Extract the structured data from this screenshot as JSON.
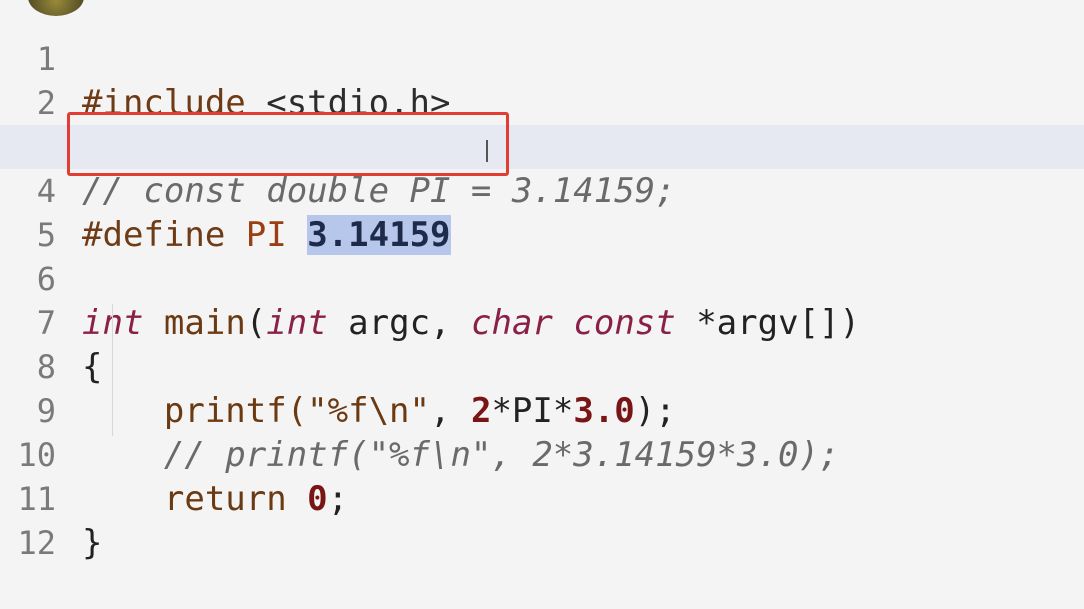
{
  "editor": {
    "lines": [
      {
        "no": "1",
        "tokens": [
          "#include",
          " <stdio.h>"
        ]
      },
      {
        "no": "2"
      },
      {
        "no": "3",
        "comment": "// const double PI = 3.14159;"
      },
      {
        "no": "4",
        "tokens": [
          "#define",
          " ",
          "PI",
          " ",
          "3.14159"
        ]
      },
      {
        "no": "5"
      },
      {
        "no": "6",
        "tokens": [
          "int",
          " ",
          "main",
          "(",
          "int",
          " argc, ",
          "char",
          " ",
          "const",
          " *argv[])"
        ]
      },
      {
        "no": "7",
        "tokens": [
          "{"
        ]
      },
      {
        "no": "8",
        "tokens": [
          "    printf(",
          "\"%f\\n\"",
          ", ",
          "2",
          "*PI*",
          "3.0",
          ");"
        ]
      },
      {
        "no": "9",
        "comment": "    // printf(\"%f\\n\", 2*3.14159*3.0);"
      },
      {
        "no": "10",
        "tokens": [
          "    return ",
          "0",
          ";"
        ]
      },
      {
        "no": "11",
        "tokens": [
          "}"
        ]
      },
      {
        "no": "12"
      }
    ]
  },
  "colors": {
    "highlight_box": "#e23d33",
    "selection": "#b7c7ec",
    "keyword": "#8a1f47"
  }
}
